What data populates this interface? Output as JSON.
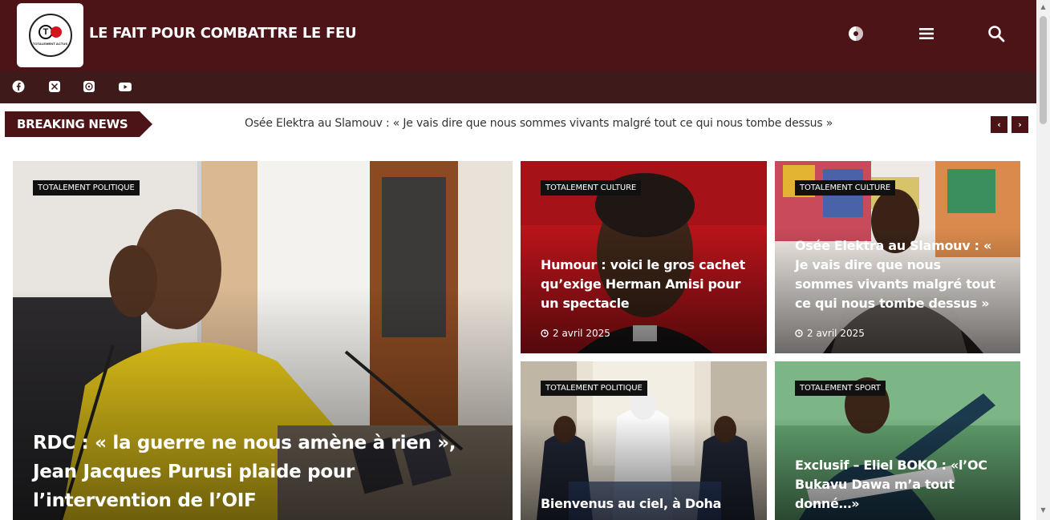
{
  "header": {
    "logo_text": "TOTALEMENT ACTUS",
    "tagline": "LE FAIT POUR COMBATTRE LE FEU",
    "icons": [
      "theme-toggle-icon",
      "menu-icon",
      "search-icon"
    ]
  },
  "social": {
    "icons": [
      "facebook-icon",
      "x-twitter-icon",
      "whatsapp-icon",
      "youtube-icon"
    ]
  },
  "breaking": {
    "label": "BREAKING NEWS",
    "ticker": "Osée Elektra au Slamouv : « Je vais dire que nous sommes vivants malgré tout ce qui nous tombe dessus »",
    "prev": "‹",
    "next": "›"
  },
  "cards": {
    "main": {
      "category": "TOTALEMENT POLITIQUE",
      "title_lines": [
        "RDC : « la guerre ne nous amène à rien »,",
        "Jean Jacques Purusi plaide pour",
        "l’intervention de l’OIF"
      ]
    },
    "c1": {
      "category": "TOTALEMENT CULTURE",
      "title_lines": [
        "Humour : voici le gros cachet",
        "qu’exige Herman Amisi pour",
        "un spectacle"
      ],
      "date": "2 avril 2025"
    },
    "c2": {
      "category": "TOTALEMENT CULTURE",
      "title_lines": [
        "Osée Elektra au Slamouv : «",
        "Je vais dire que nous",
        "sommes vivants malgré tout",
        "ce qui nous tombe dessus »"
      ],
      "date": "2 avril 2025"
    },
    "c3": {
      "category": "TOTALEMENT POLITIQUE",
      "title_lines": [
        "Bienvenus au ciel, à Doha"
      ]
    },
    "c4": {
      "category": "TOTALEMENT SPORT",
      "title_lines": [
        "Exclusif – Eliel BOKO : «l’OC",
        "Bukavu Dawa m’a tout",
        "donné…»"
      ]
    }
  },
  "colors": {
    "header_bg": "#4d1417",
    "social_bg": "#3e1a1b",
    "accent": "#4d1417",
    "badge_bg": "#111111"
  }
}
